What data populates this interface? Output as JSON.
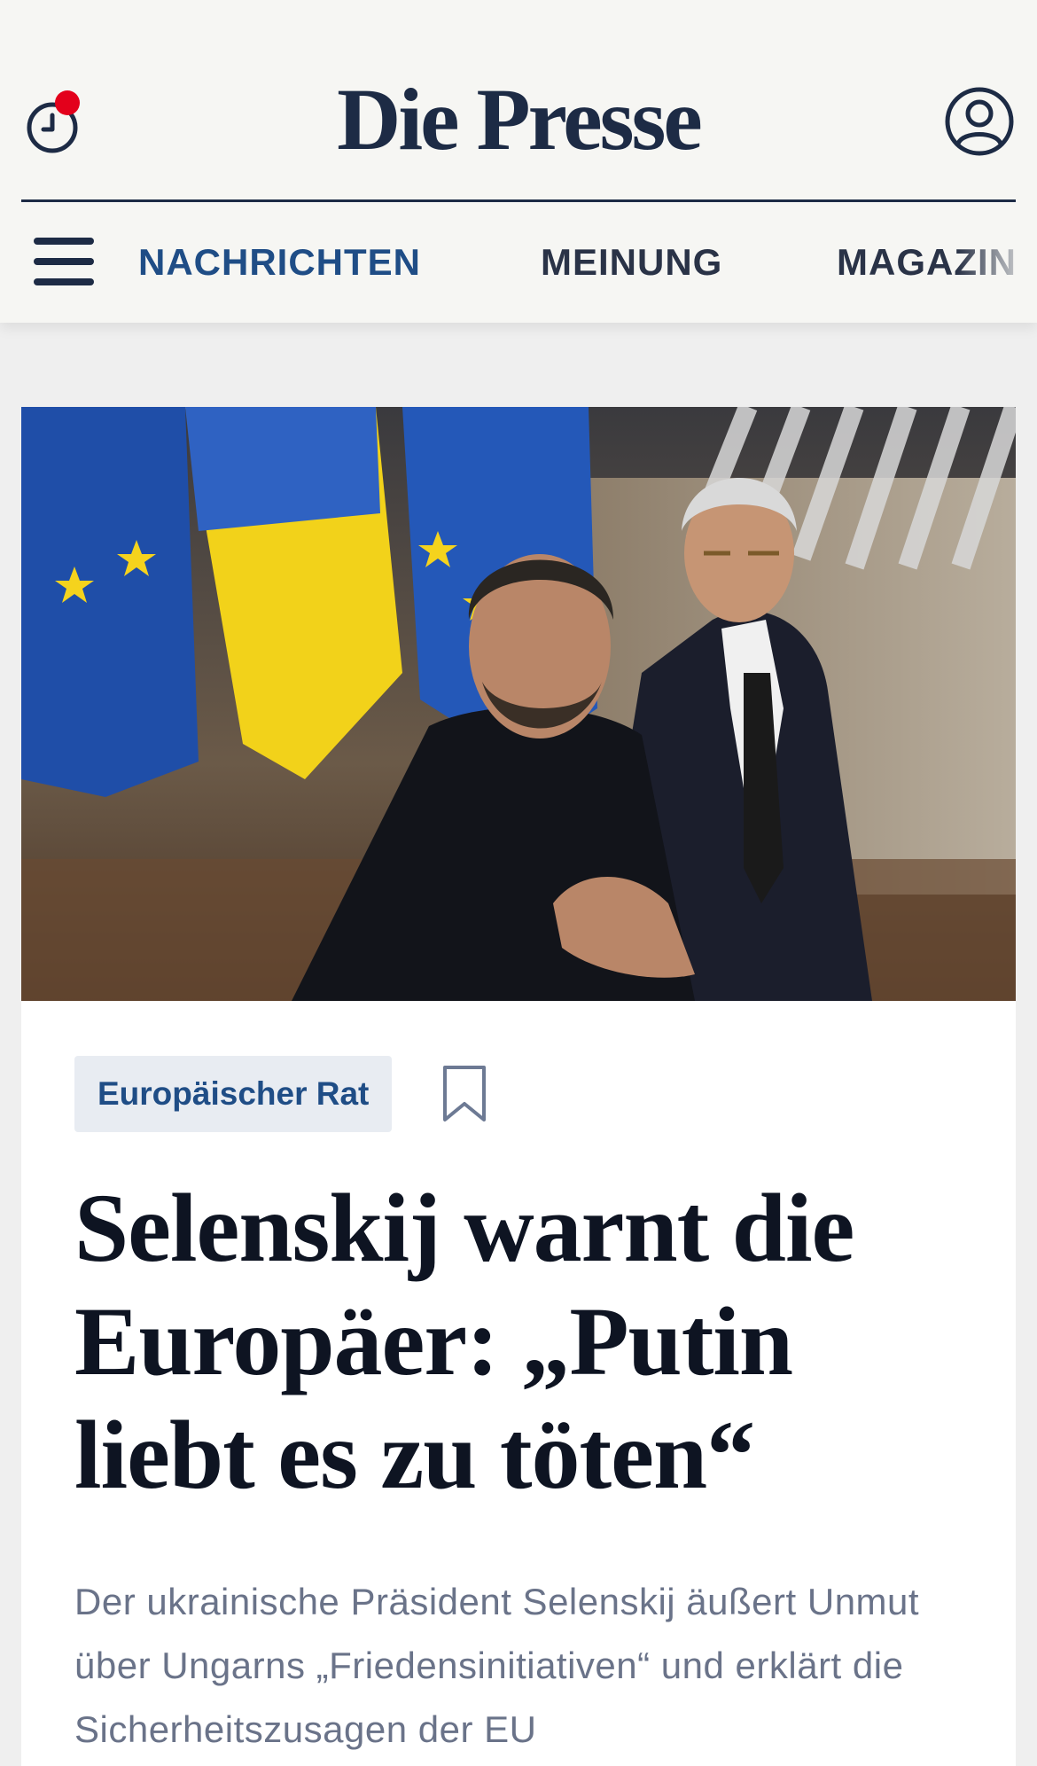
{
  "header": {
    "logo_text": "Die Presse",
    "history_icon": "history-clock-icon",
    "notification_badge_color": "#e3001b",
    "account_icon": "user-account-icon",
    "brand_color": "#1d2b45"
  },
  "nav": {
    "menu_icon": "hamburger-menu-icon",
    "items": [
      {
        "label": "NACHRICHTEN",
        "active": true
      },
      {
        "label": "MEINUNG",
        "active": false
      },
      {
        "label": "MAGAZIN",
        "active": false
      }
    ],
    "active_color": "#1f4d86"
  },
  "article": {
    "image_alt": "Selenskij und Costa vor EU- und Ukraine-Flaggen",
    "category": "Europäischer Rat",
    "bookmark_icon": "bookmark-icon",
    "headline": "Selenskij warnt die Europäer: „Putin liebt es zu töten“",
    "lead": "Der ukrainische Präsident Selenskij äußert Unmut über Ungarns „Friedensinitiativen“ und erklärt die Sicherheitszusagen der EU"
  }
}
